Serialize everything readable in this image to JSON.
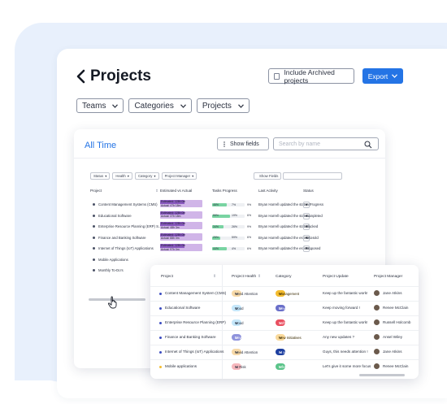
{
  "header": {
    "title": "Projects",
    "include_archived_label": "Include Archived projects",
    "export_label": "Export"
  },
  "filters": [
    "Teams",
    "Categories",
    "Projects"
  ],
  "card1": {
    "title": "All Time",
    "show_fields_label": "Show fields",
    "search_placeholder": "Search by name",
    "inner": {
      "chips": [
        "Status",
        "Health",
        "Category",
        "Project Manager"
      ],
      "show_fields_label": "Show Fields",
      "columns": [
        "Project",
        "Estimated vs Actual",
        "Tasks Progress",
        "Last Activity",
        "Status"
      ],
      "rows": [
        {
          "project": "Content Management Systems (CMS)",
          "est": "Estimated: 128h 0m",
          "act": "Actual: 47h 18m",
          "prog": [
            46,
            7,
            9
          ],
          "progress": 0.46,
          "activity": "Bryan Harrell updated the status...",
          "status": "In Progress"
        },
        {
          "project": "Educational Software",
          "est": "Estimated: 128h 0m",
          "act": "Actual: 37h 18m",
          "prog": [
            55,
            19,
            6
          ],
          "progress": 0.55,
          "activity": "Bryan Harrell updated the status...",
          "status": "Completed"
        },
        {
          "project": "Enterprise Resource Planning (ERP) S...",
          "est": "Estimated: 128h 0m",
          "act": "Actual: 48h 3m",
          "prog": [
            34,
            26,
            9
          ],
          "progress": 0.34,
          "activity": "Bryan Harrell updated the status...",
          "status": "Blocked"
        },
        {
          "project": "Finance and Banking Software",
          "est": "Estimated: 128h 0m",
          "act": "Actual: 88h 0m",
          "prog": [
            25,
            59,
            6
          ],
          "progress": 0.25,
          "activity": "Bryan Harrell updated the estimat...",
          "status": "On Hold"
        },
        {
          "project": "Internet of Things (IoT) Applications",
          "est": "Estimated: 128h 0m",
          "act": "Actual: 97h 0m",
          "prog": [
            44,
            4,
            6
          ],
          "progress": 0.44,
          "activity": "Bryan Harrell updated the estima...",
          "status": "Proposed"
        },
        {
          "project": "Mobile Applications"
        },
        {
          "project": "Monthly To-Do's"
        }
      ]
    }
  },
  "card2": {
    "columns": [
      "Project",
      "Project Health",
      "Category",
      "Project Update",
      "Project Manager"
    ],
    "rows": [
      {
        "project": "Content Management System (CMS)",
        "health": "Need Attention",
        "health_color": "#f7d9a8",
        "category": "Management",
        "category_color": "#f4bc2f",
        "update": "Keep up the fantastic work!",
        "manager": "Jane Atkins",
        "dot": "#3b4cc0"
      },
      {
        "project": "Educational Software",
        "health": "Good",
        "health_color": "#c5e7fa",
        "category": "Development",
        "category_color": "#6a6fc9",
        "update": "Keep moving forward !",
        "manager": "Renee McClain",
        "dot": "#3b4cc0"
      },
      {
        "project": "Enterprise Resource Planning (ERP)",
        "health": "Good",
        "health_color": "#c5e7fa",
        "category": "Software Support",
        "category_color": "#e94f60",
        "update": "Keep up the fantastic work!",
        "manager": "Russell Holcomb",
        "dot": "#3b4cc0"
      },
      {
        "project": "Finance and Banking Software",
        "health": "Development",
        "health_color": "#8f93dc",
        "category": "New Initiatives",
        "category_color": "#f9d99b",
        "update": "Any new updates ?",
        "manager": "Ansel Wiley",
        "dot": "#3b4cc0"
      },
      {
        "project": "Internet of Things (IoT) Applications",
        "health": "Need Attention",
        "health_color": "#f7d9a8",
        "category": "AI and ML",
        "category_color": "#1d3fa0",
        "update": "Guys, this needs attention !",
        "manager": "Jane Atkins",
        "dot": "#3b4cc0"
      },
      {
        "project": "Mobile applications",
        "health": "At Risk",
        "health_color": "#f6b7bd",
        "category": "Infrastructure",
        "category_color": "#5bc48a",
        "update": "Let's give it some more focus",
        "manager": "Renee McClain",
        "dot": "#f4bc2f"
      }
    ]
  },
  "colors": {
    "accent": "#2474e5",
    "background_blob": "#e8f0fc"
  },
  "icons": {
    "back": "chevron-left-icon",
    "export": "chevron-down-icon",
    "search": "search-icon",
    "cursor": "hand-pointer-icon",
    "show_fields": "vertical-dots-icon"
  }
}
